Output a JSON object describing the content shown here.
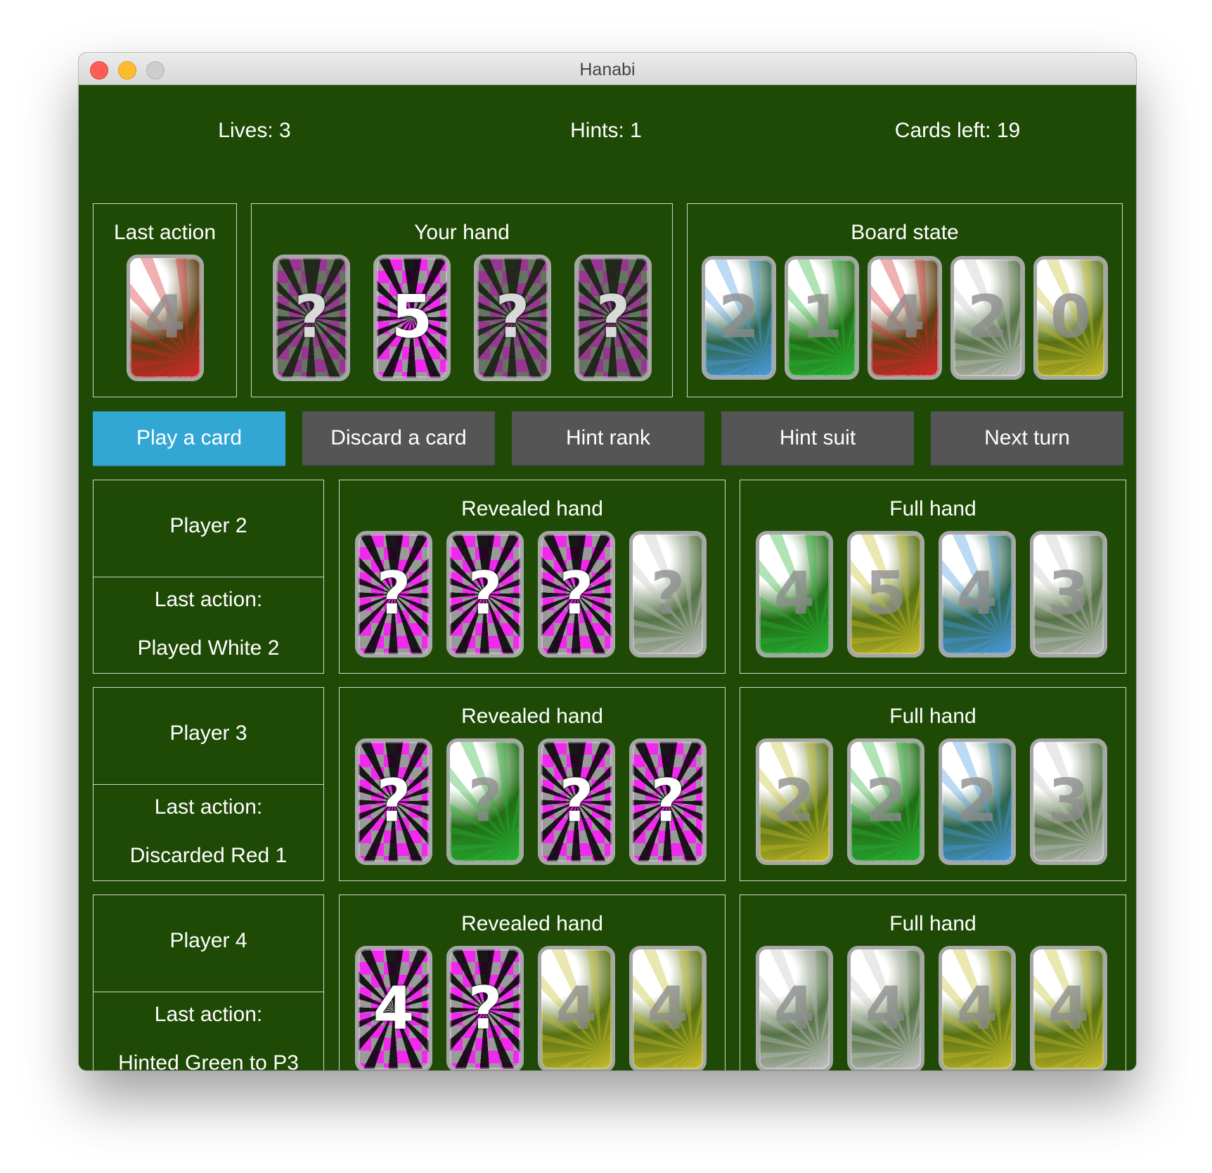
{
  "window": {
    "title": "Hanabi"
  },
  "stats": {
    "lives": "Lives: 3",
    "hints": "Hints: 1",
    "cards_left": "Cards left: 19"
  },
  "colors": {
    "red": "#d8262a",
    "green": "#28b335",
    "blue": "#4b9be0",
    "white": "#c4c4c4",
    "yellow": "#c9bd2b",
    "pink": "#f02aed",
    "back_check": "#9a9a9a",
    "table": "#1e4a06",
    "active_button": "#33a7d4"
  },
  "last_action_panel": {
    "title": "Last action",
    "card": {
      "type": "face",
      "color": "red",
      "label": "4"
    }
  },
  "your_hand": {
    "title": "Your hand",
    "cards": [
      {
        "type": "back",
        "label": "?",
        "dim": true
      },
      {
        "type": "back",
        "label": "5",
        "dim": false
      },
      {
        "type": "back",
        "label": "?",
        "dim": true
      },
      {
        "type": "back",
        "label": "?",
        "dim": true
      }
    ]
  },
  "board_state": {
    "title": "Board state",
    "cards": [
      {
        "type": "face",
        "color": "blue",
        "label": "2"
      },
      {
        "type": "face",
        "color": "green",
        "label": "1"
      },
      {
        "type": "face",
        "color": "red",
        "label": "4"
      },
      {
        "type": "face",
        "color": "white",
        "label": "2"
      },
      {
        "type": "face",
        "color": "yellow",
        "label": "0"
      }
    ]
  },
  "actions": [
    {
      "label": "Play a card",
      "active": true
    },
    {
      "label": "Discard a card",
      "active": false
    },
    {
      "label": "Hint rank",
      "active": false
    },
    {
      "label": "Hint suit",
      "active": false
    },
    {
      "label": "Next turn",
      "active": false
    }
  ],
  "players": [
    {
      "name": "Player 2",
      "last_action_label": "Last action:",
      "last_action": "Played White 2",
      "revealed_title": "Revealed hand",
      "full_title": "Full hand",
      "revealed": [
        {
          "type": "back",
          "label": "?"
        },
        {
          "type": "back",
          "label": "?"
        },
        {
          "type": "back",
          "label": "?"
        },
        {
          "type": "face",
          "color": "white",
          "label": "?"
        }
      ],
      "full": [
        {
          "type": "face",
          "color": "green",
          "label": "4"
        },
        {
          "type": "face",
          "color": "yellow",
          "label": "5"
        },
        {
          "type": "face",
          "color": "blue",
          "label": "4"
        },
        {
          "type": "face",
          "color": "white",
          "label": "3"
        }
      ]
    },
    {
      "name": "Player 3",
      "last_action_label": "Last action:",
      "last_action": "Discarded Red 1",
      "revealed_title": "Revealed hand",
      "full_title": "Full hand",
      "revealed": [
        {
          "type": "back",
          "label": "?"
        },
        {
          "type": "face",
          "color": "green",
          "label": "?"
        },
        {
          "type": "back",
          "label": "?"
        },
        {
          "type": "back",
          "label": "?"
        }
      ],
      "full": [
        {
          "type": "face",
          "color": "yellow",
          "label": "2"
        },
        {
          "type": "face",
          "color": "green",
          "label": "2"
        },
        {
          "type": "face",
          "color": "blue",
          "label": "2"
        },
        {
          "type": "face",
          "color": "white",
          "label": "3"
        }
      ]
    },
    {
      "name": "Player 4",
      "last_action_label": "Last action:",
      "last_action": "Hinted Green to P3",
      "revealed_title": "Revealed hand",
      "full_title": "Full hand",
      "revealed": [
        {
          "type": "back",
          "label": "4"
        },
        {
          "type": "back",
          "label": "?"
        },
        {
          "type": "face",
          "color": "yellow",
          "label": "4"
        },
        {
          "type": "face",
          "color": "yellow",
          "label": "4"
        }
      ],
      "full": [
        {
          "type": "face",
          "color": "white",
          "label": "4"
        },
        {
          "type": "face",
          "color": "white",
          "label": "4"
        },
        {
          "type": "face",
          "color": "yellow",
          "label": "4"
        },
        {
          "type": "face",
          "color": "yellow",
          "label": "4"
        }
      ]
    }
  ]
}
